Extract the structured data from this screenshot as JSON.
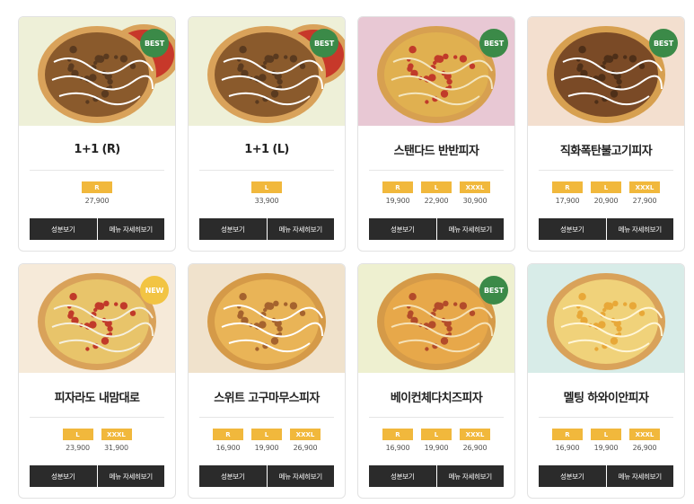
{
  "colors": {
    "best_badge": "#3b8a48",
    "new_badge": "#f2c443",
    "size_tag": "#f1b83c",
    "button": "#2b2b2b"
  },
  "buttons": {
    "ingredients": "성분보기",
    "details": "메뉴 자세히보기"
  },
  "products": [
    {
      "name": "1+1 (R)",
      "badge": "BEST",
      "photo_bg": "#eef0d8",
      "sizes": [
        {
          "size": "R",
          "price": "27,900"
        }
      ]
    },
    {
      "name": "1+1 (L)",
      "badge": "BEST",
      "photo_bg": "#eef0d8",
      "sizes": [
        {
          "size": "L",
          "price": "33,900"
        }
      ]
    },
    {
      "name": "스탠다드 반반피자",
      "badge": "BEST",
      "photo_bg": "#e8c8d4",
      "sizes": [
        {
          "size": "R",
          "price": "19,900"
        },
        {
          "size": "L",
          "price": "22,900"
        },
        {
          "size": "XXXL",
          "price": "30,900"
        }
      ]
    },
    {
      "name": "직화폭탄불고기피자",
      "badge": "BEST",
      "photo_bg": "#f3dfcf",
      "sizes": [
        {
          "size": "R",
          "price": "17,900"
        },
        {
          "size": "L",
          "price": "20,900"
        },
        {
          "size": "XXXL",
          "price": "27,900"
        }
      ]
    },
    {
      "name": "피자라도 내맘대로",
      "badge": "NEW",
      "photo_bg": "#f6ead9",
      "sizes": [
        {
          "size": "L",
          "price": "23,900"
        },
        {
          "size": "XXXL",
          "price": "31,900"
        }
      ]
    },
    {
      "name": "스위트 고구마무스피자",
      "badge": "",
      "photo_bg": "#f0e2cc",
      "sizes": [
        {
          "size": "R",
          "price": "16,900"
        },
        {
          "size": "L",
          "price": "19,900"
        },
        {
          "size": "XXXL",
          "price": "26,900"
        }
      ]
    },
    {
      "name": "베이컨체다치즈피자",
      "badge": "BEST",
      "photo_bg": "#eef0d0",
      "sizes": [
        {
          "size": "R",
          "price": "16,900"
        },
        {
          "size": "L",
          "price": "19,900"
        },
        {
          "size": "XXXL",
          "price": "26,900"
        }
      ]
    },
    {
      "name": "멜팅 하와이안피자",
      "badge": "",
      "photo_bg": "#d8ece8",
      "sizes": [
        {
          "size": "R",
          "price": "16,900"
        },
        {
          "size": "L",
          "price": "19,900"
        },
        {
          "size": "XXXL",
          "price": "26,900"
        }
      ]
    }
  ]
}
